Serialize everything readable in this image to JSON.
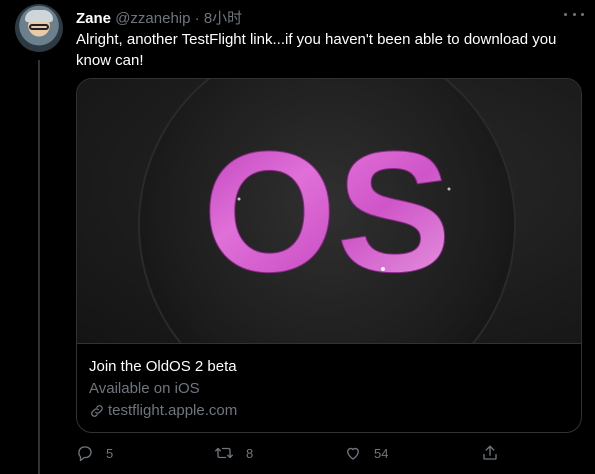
{
  "tweet": {
    "author_name": "Zane",
    "author_handle": "@zzanehip",
    "separator": "·",
    "timestamp": "8小时",
    "text": "Alright, another TestFlight link...if you haven't been able to download you know can!"
  },
  "card": {
    "image_text": "OS",
    "title": "Join the OldOS 2 beta",
    "subtitle": "Available on iOS",
    "url": "testflight.apple.com"
  },
  "actions": {
    "reply_count": "5",
    "retweet_count": "8",
    "like_count": "54"
  },
  "colors": {
    "background": "#000000",
    "muted": "#6e767d",
    "border": "#2f3336",
    "text": "#ffffff",
    "os_gradient_start": "#c83fc8",
    "os_gradient_end": "#e58fe0"
  },
  "icons": [
    "more-icon",
    "reply-icon",
    "retweet-icon",
    "like-icon",
    "share-icon",
    "link-icon"
  ]
}
